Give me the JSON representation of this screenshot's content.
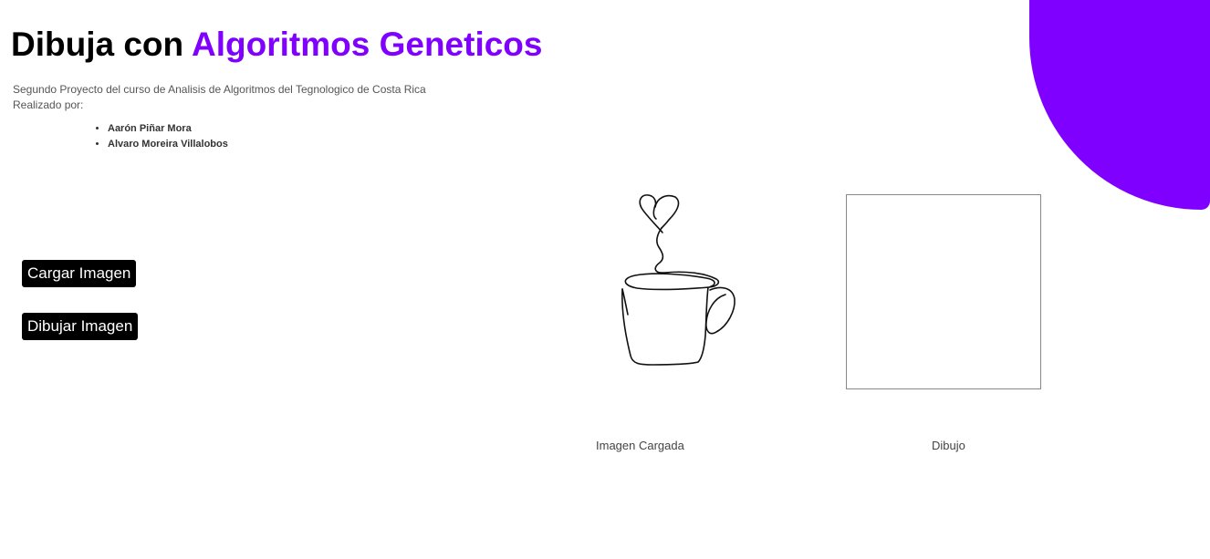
{
  "header": {
    "title_prefix": "Dibuja con ",
    "title_accent": "Algoritmos Geneticos",
    "subtitle": "Segundo Proyecto del curso de Analisis de Algoritmos del Tegnologico de Costa Rica",
    "made_by": "Realizado por:",
    "authors": [
      "Aarón Piñar Mora",
      "Alvaro Moreira Villalobos"
    ]
  },
  "actions": {
    "load_label": "Cargar Imagen",
    "draw_label": "Dibujar Imagen"
  },
  "panels": {
    "loaded_caption": "Imagen Cargada",
    "drawing_caption": "Dibujo"
  },
  "colors": {
    "accent": "#8000ff",
    "button_bg": "#000000"
  },
  "icons": {
    "loaded_image": "coffee-cup-heart-line-art"
  }
}
